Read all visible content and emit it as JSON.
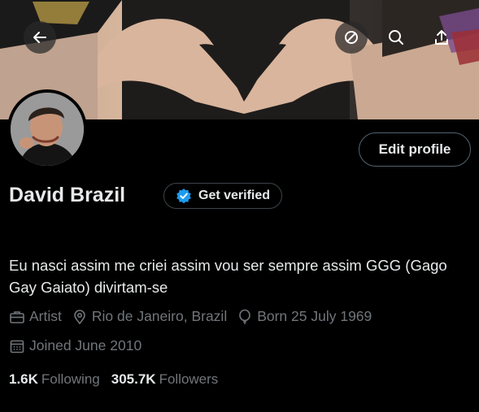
{
  "profile": {
    "name": "David Brazil",
    "verify_label": "Get verified",
    "edit_label": "Edit profile",
    "bio": "Eu nasci assim me criei assim vou ser sempre assim GGG (Gago Gay Gaiato) divirtam-se",
    "category": "Artist",
    "location": "Rio de Janeiro, Brazil",
    "born": "Born 25 July 1969",
    "joined": "Joined June 2010"
  },
  "stats": {
    "following_count": "1.6K",
    "following_label": "Following",
    "followers_count": "305.7K",
    "followers_label": "Followers"
  },
  "icons": {
    "back": "arrow-left-icon",
    "clear": "no-circle-icon",
    "search": "search-icon",
    "share": "share-icon",
    "verified": "verified-badge-icon",
    "category": "briefcase-icon",
    "location": "location-pin-icon",
    "born": "balloon-icon",
    "joined": "calendar-icon"
  },
  "colors": {
    "background": "#000000",
    "text": "#e7e9ea",
    "muted": "#71767b",
    "verified_blue": "#1d9bf0",
    "border": "#536471"
  }
}
